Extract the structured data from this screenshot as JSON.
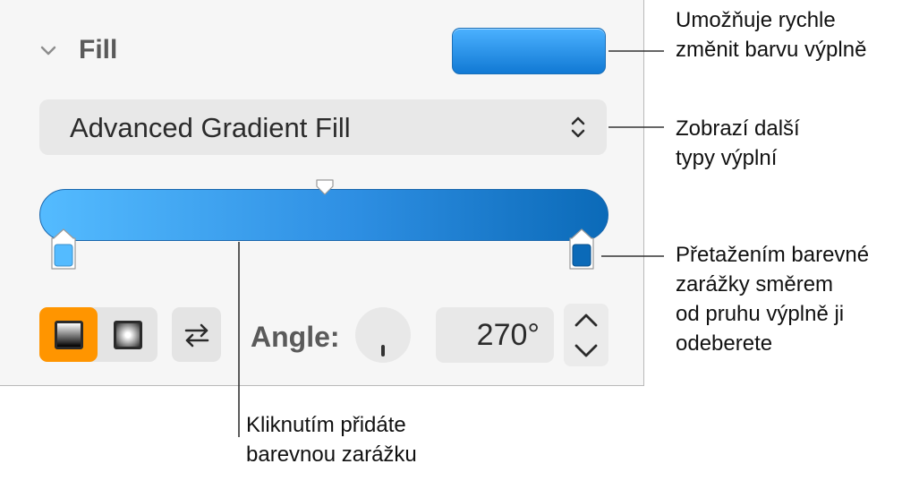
{
  "fill_section": {
    "title": "Fill",
    "swatch_color": "#1a85e6",
    "fill_type": "Advanced Gradient Fill",
    "gradient": {
      "start_color": "#54bbff",
      "end_color": "#0b6ab8"
    },
    "gradient_style_selected": "linear",
    "angle_label": "Angle:",
    "angle_value": "270°"
  },
  "icons": {
    "collapse": "chevron-down-icon",
    "popup": "updown-chevron-icon",
    "reverse": "reverse-arrows-icon",
    "stepper_up": "chevron-up-icon",
    "stepper_down": "chevron-down-icon"
  },
  "accent_color": "#ff9500",
  "callouts": {
    "swatch": "Umožňuje rychle\nzměnit barvu výplně",
    "popup": "Zobrazí další\ntypy výplní",
    "stop": "Přetažením barevné\nzarážky směrem\nod pruhu výplně ji\nodeberete",
    "add_stop": "Kliknutím přidáte\nbarevnou zarážku"
  }
}
